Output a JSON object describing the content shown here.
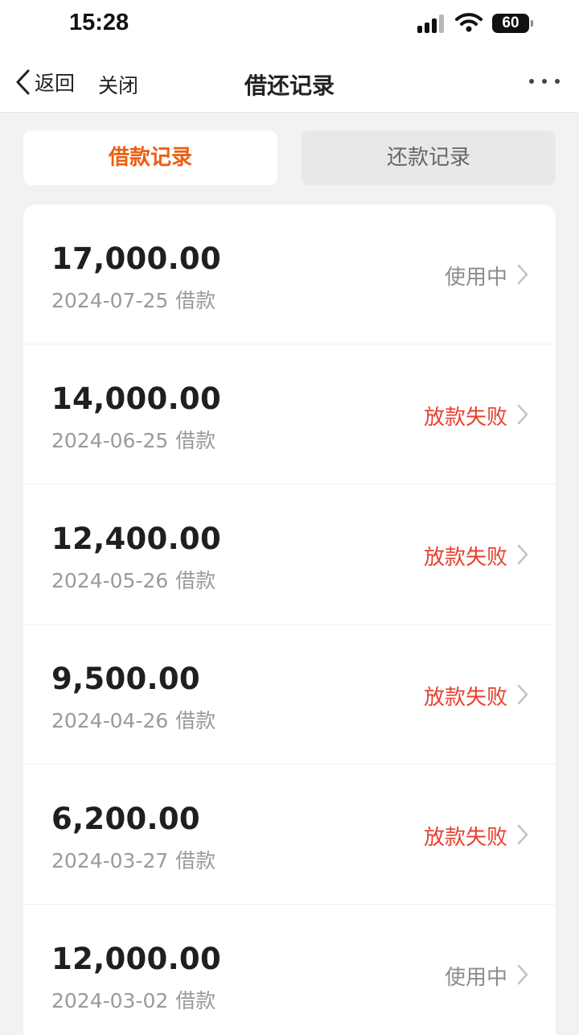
{
  "status_bar": {
    "time": "15:28",
    "battery": "60"
  },
  "nav": {
    "back_label": "返回",
    "close_label": "关闭",
    "title": "借还记录"
  },
  "tabs": [
    {
      "label": "借款记录",
      "active": true
    },
    {
      "label": "还款记录",
      "active": false
    }
  ],
  "records": [
    {
      "amount": "17,000.00",
      "date": "2024-07-25",
      "type": "借款",
      "status": "使用中",
      "failed": false
    },
    {
      "amount": "14,000.00",
      "date": "2024-06-25",
      "type": "借款",
      "status": "放款失败",
      "failed": true
    },
    {
      "amount": "12,400.00",
      "date": "2024-05-26",
      "type": "借款",
      "status": "放款失败",
      "failed": true
    },
    {
      "amount": "9,500.00",
      "date": "2024-04-26",
      "type": "借款",
      "status": "放款失败",
      "failed": true
    },
    {
      "amount": "6,200.00",
      "date": "2024-03-27",
      "type": "借款",
      "status": "放款失败",
      "failed": true
    },
    {
      "amount": "12,000.00",
      "date": "2024-03-02",
      "type": "借款",
      "status": "使用中",
      "failed": false
    }
  ],
  "colors": {
    "accent": "#ec5f12",
    "failed": "#e8402f",
    "muted": "#8c8c8c",
    "background": "#f2f2f3"
  }
}
